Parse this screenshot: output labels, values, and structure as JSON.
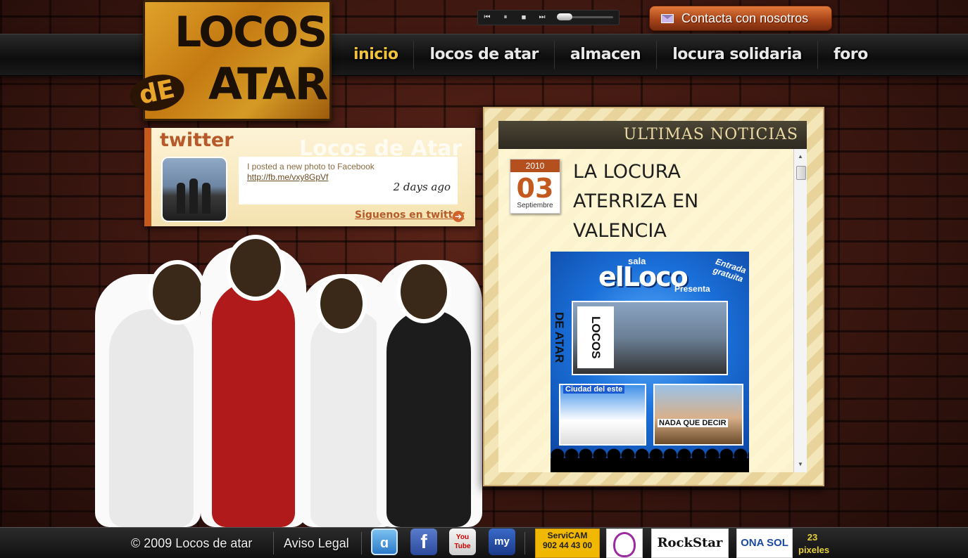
{
  "player": {
    "prev": "⏮",
    "pause": "⏸",
    "stop": "■",
    "next": "⏭"
  },
  "contact": {
    "label": "Contacta con nosotros"
  },
  "logo": {
    "line1": "LOCOS",
    "de": "dE",
    "line2": "ATAR"
  },
  "nav": {
    "items": [
      {
        "label": "inicio"
      },
      {
        "label": "locos de atar"
      },
      {
        "label": "almacen"
      },
      {
        "label": "locura solidaria"
      },
      {
        "label": "foro"
      }
    ]
  },
  "twitter": {
    "title": "twitter",
    "watermark": "Locos de Atar",
    "tweet_text": "I posted a new photo to Facebook",
    "tweet_link": "http://fb.me/vxy8GpVf",
    "time": "2 days ago",
    "follow": "Siguenos en twitter"
  },
  "news": {
    "header": "ULTIMAS NOTICIAS",
    "date": {
      "year": "2010",
      "day": "03",
      "month": "Septiembre"
    },
    "title": "LA LOCURA ATERRIZA EN VALENCIA",
    "poster": {
      "sala": "sala",
      "elloco": "elLoco",
      "presenta": "Presenta",
      "free": "Entrada gratuita",
      "band": "LOCOS DE ATAR",
      "cap2": "Ciudad del este",
      "cap3": "NADA QUE DECIR"
    }
  },
  "footer": {
    "copyright": "© 2009  Locos de atar",
    "legal": "Aviso Legal",
    "social": [
      {
        "label": "ɑ"
      },
      {
        "label": "f"
      },
      {
        "label": "You Tube"
      },
      {
        "label": "my"
      }
    ],
    "sponsors": [
      {
        "name": "ServiCAM",
        "phone": "902 44 43 00"
      },
      {
        "name": ""
      },
      {
        "name": "RockStar"
      },
      {
        "name": "ONA SOL"
      },
      {
        "name": "23 pixeles"
      }
    ]
  },
  "colors": {
    "accent": "#f2c23a",
    "brand_orange": "#c45a1c",
    "nav_bg": "#111111"
  }
}
